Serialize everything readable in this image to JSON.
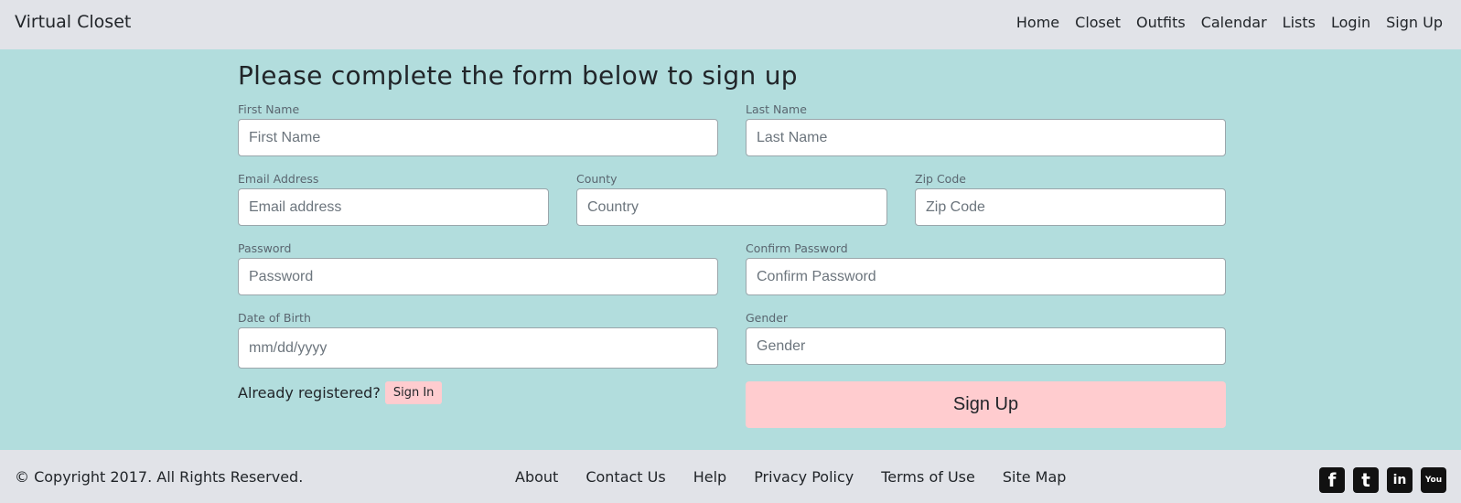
{
  "nav": {
    "brand": "Virtual Closet",
    "links": [
      "Home",
      "Closet",
      "Outfits",
      "Calendar",
      "Lists",
      "Login",
      "Sign Up"
    ]
  },
  "form": {
    "title": "Please complete the form below to sign up",
    "first_name": {
      "label": "First Name",
      "placeholder": "First Name"
    },
    "last_name": {
      "label": "Last Name",
      "placeholder": "Last Name"
    },
    "email": {
      "label": "Email Address",
      "placeholder": "Email address"
    },
    "county": {
      "label": "County",
      "placeholder": "Country"
    },
    "zip": {
      "label": "Zip Code",
      "placeholder": "Zip Code"
    },
    "password": {
      "label": "Password",
      "placeholder": "Password"
    },
    "confirm_password": {
      "label": "Confirm Password",
      "placeholder": "Confirm Password"
    },
    "dob": {
      "label": "Date of Birth",
      "placeholder": "mm/dd/yyyy"
    },
    "gender": {
      "label": "Gender",
      "placeholder": "Gender"
    },
    "already_text": "Already registered?",
    "signin_label": "Sign In",
    "signup_label": "Sign Up"
  },
  "footer": {
    "copyright": "© Copyright 2017. All Rights Reserved.",
    "links": [
      "About",
      "Contact Us",
      "Help",
      "Privacy Policy",
      "Terms of Use",
      "Site Map"
    ],
    "social": [
      {
        "icon": "facebook-icon",
        "glyph": "f"
      },
      {
        "icon": "twitter-icon",
        "glyph": "t"
      },
      {
        "icon": "linkedin-icon",
        "glyph": "in"
      },
      {
        "icon": "youtube-icon",
        "glyph": "You"
      }
    ]
  },
  "colors": {
    "navbar_bg": "#e1e3e8",
    "main_bg": "#b2dddd",
    "button_bg": "#ffcccf"
  }
}
